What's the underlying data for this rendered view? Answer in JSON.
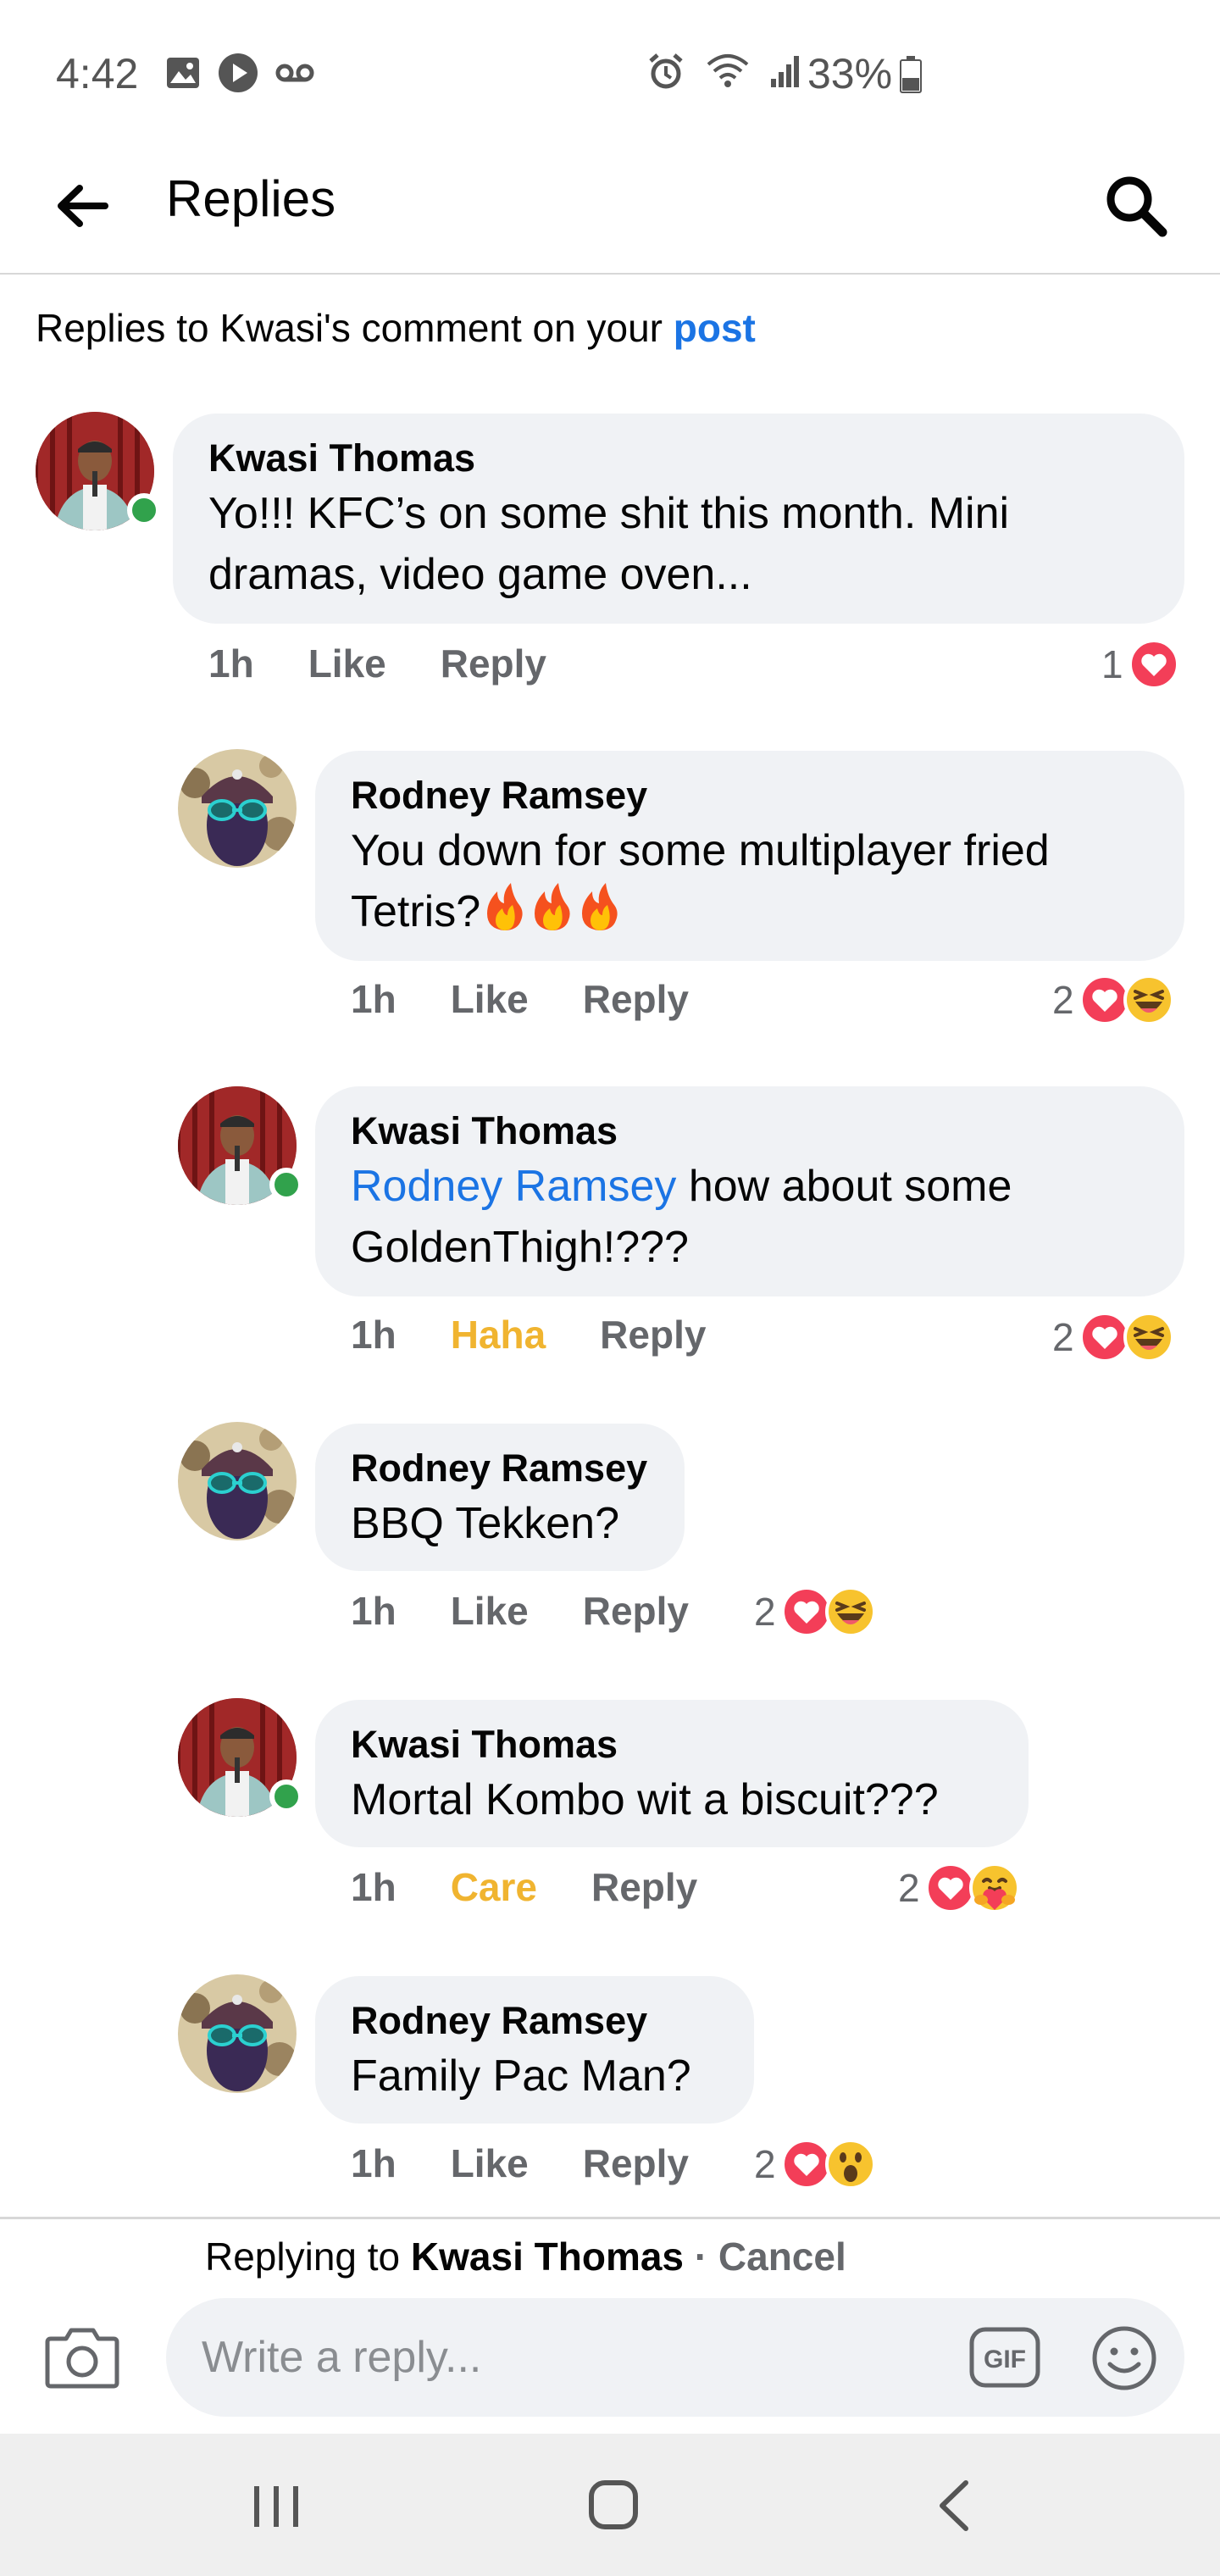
{
  "status_bar": {
    "time": "4:42",
    "battery": "33%",
    "icons_left": [
      "gallery-icon",
      "play-icon",
      "voicemail-icon"
    ],
    "icons_right": [
      "alarm-icon",
      "wifi-icon",
      "signal-icon",
      "battery-icon"
    ]
  },
  "header": {
    "title": "Replies"
  },
  "context": {
    "prefix": "Replies to Kwasi's comment on your ",
    "link": "post"
  },
  "comments": [
    {
      "name": "Kwasi Thomas",
      "text": "Yo!!! KFC’s on some shit this month. Mini dramas, video game oven...",
      "time": "1h",
      "like": "Like",
      "reply": "Reply",
      "reaction_count": "1",
      "reactions": [
        "love"
      ]
    },
    {
      "name": "Rodney Ramsey",
      "text": "You down for some multiplayer fried Tetris?",
      "time": "1h",
      "like": "Like",
      "reply": "Reply",
      "reaction_count": "2",
      "reactions": [
        "love",
        "haha"
      ]
    },
    {
      "name": "Kwasi Thomas",
      "mention": "Rodney Ramsey",
      "text": " how about some GoldenThigh!???",
      "time": "1h",
      "like": "Haha",
      "reply": "Reply",
      "reaction_count": "2",
      "reactions": [
        "love",
        "haha"
      ]
    },
    {
      "name": "Rodney Ramsey",
      "text": "BBQ Tekken?",
      "time": "1h",
      "like": "Like",
      "reply": "Reply",
      "reaction_count": "2",
      "reactions": [
        "love",
        "haha"
      ]
    },
    {
      "name": "Kwasi Thomas",
      "text": "Mortal Kombo wit a biscuit???",
      "time": "1h",
      "like": "Care",
      "reply": "Reply",
      "reaction_count": "2",
      "reactions": [
        "love",
        "care"
      ]
    },
    {
      "name": "Rodney Ramsey",
      "text": "Family Pac Man?",
      "time": "1h",
      "like": "Like",
      "reply": "Reply",
      "reaction_count": "2",
      "reactions": [
        "love",
        "wow"
      ]
    }
  ],
  "reply_bar": {
    "prefix": "Replying to ",
    "name": "Kwasi Thomas",
    "separator": " · ",
    "cancel": "Cancel",
    "placeholder": "Write a reply...",
    "gif": "GIF"
  },
  "colors": {
    "link": "#1b74e4",
    "reaction_active": "#f0b430",
    "online": "#31a24c",
    "bubble": "#f0f2f5",
    "love": "#f33e58"
  }
}
